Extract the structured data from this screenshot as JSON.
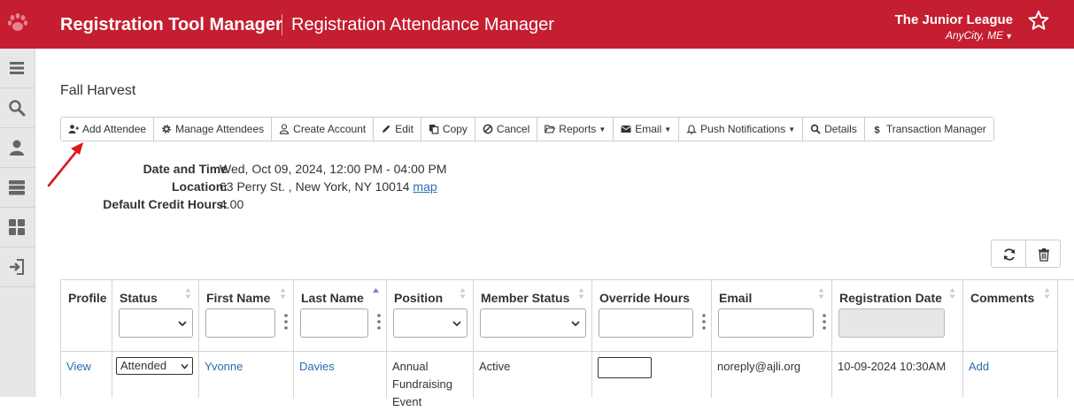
{
  "header": {
    "app_title": "Registration Tool Manager",
    "sub_title": "Registration Attendance Manager",
    "org_name": "The Junior League",
    "org_location": "AnyCity, ME",
    "brand_color": "#c41e30"
  },
  "sidebar": {
    "items": [
      {
        "icon": "menu-icon"
      },
      {
        "icon": "search-icon"
      },
      {
        "icon": "user-icon"
      },
      {
        "icon": "server-icon"
      },
      {
        "icon": "dashboard-icon"
      },
      {
        "icon": "sign-in-icon"
      }
    ]
  },
  "event": {
    "title": "Fall Harvest",
    "date_label": "Date and Time",
    "date_value": "Wed, Oct 09, 2024, 12:00 PM - 04:00 PM",
    "location_label": "Location:",
    "location_value": "63 Perry St. , New York, NY 10014",
    "map_link": "map",
    "credit_label": "Default Credit Hours:",
    "credit_value": "4.00"
  },
  "toolbar": {
    "add_attendee": "Add Attendee",
    "manage_attendees": "Manage Attendees",
    "create_account": "Create Account",
    "edit": "Edit",
    "copy": "Copy",
    "cancel": "Cancel",
    "reports": "Reports",
    "email": "Email",
    "push_notifications": "Push Notifications",
    "details": "Details",
    "transaction_manager": "Transaction Manager"
  },
  "table": {
    "columns": {
      "profile": "Profile",
      "status": "Status",
      "first_name": "First Name",
      "last_name": "Last Name",
      "position": "Position",
      "member_status": "Member Status",
      "override_hours": "Override Hours",
      "email": "Email",
      "registration_date": "Registration Date",
      "comments": "Comments"
    },
    "row": {
      "profile": "View",
      "status": "Attended",
      "first_name": "Yvonne",
      "last_name": "Davies",
      "position_line1": "Annual",
      "position_line2": "Fundraising",
      "position_line3": "Event",
      "member_status": "Active",
      "email": "noreply@ajli.org",
      "registration_date": "10-09-2024 10:30AM",
      "comments": "Add"
    }
  }
}
